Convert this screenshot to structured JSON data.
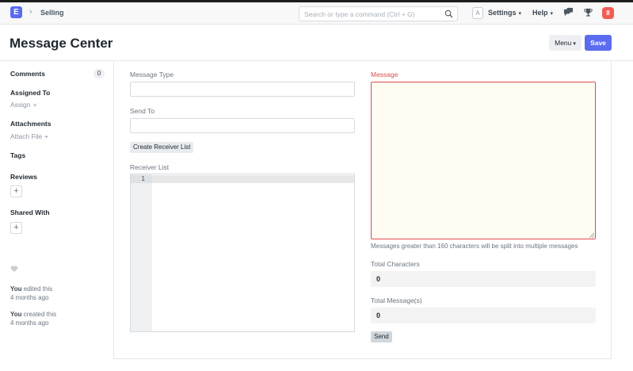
{
  "navbar": {
    "logo_letter": "E",
    "breadcrumb": "Selling",
    "search_placeholder": "Search or type a command (Ctrl + G)",
    "avatar_letter": "A",
    "settings_label": "Settings",
    "help_label": "Help",
    "notification_count": "8",
    "icons": [
      "chevron-right-icon",
      "search-icon",
      "chat-icon",
      "trophy-icon"
    ]
  },
  "page": {
    "title": "Message Center",
    "menu_label": "Menu",
    "save_label": "Save",
    "accent_color": "#5b6cf0"
  },
  "sidebar": {
    "comments_label": "Comments",
    "comments_count": "0",
    "assigned_to_label": "Assigned To",
    "assign_link": "Assign",
    "attachments_label": "Attachments",
    "attach_file_link": "Attach File",
    "tags_label": "Tags",
    "reviews_label": "Reviews",
    "shared_with_label": "Shared With",
    "activity": [
      {
        "who": "You",
        "action": "edited this",
        "when": "4 months ago"
      },
      {
        "who": "You",
        "action": "created this",
        "when": "4 months ago"
      }
    ]
  },
  "form": {
    "message_type_label": "Message Type",
    "message_type_value": "",
    "send_to_label": "Send To",
    "send_to_value": "",
    "create_receiver_list_label": "Create Receiver List",
    "receiver_list_label": "Receiver List",
    "receiver_list_line_number": "1",
    "message_label": "Message",
    "message_value": "",
    "message_help": "Messages greater than 160 characters will be split into multiple messages",
    "total_characters_label": "Total Characters",
    "total_characters_value": "0",
    "total_messages_label": "Total Message(s)",
    "total_messages_value": "0",
    "send_label": "Send",
    "required_color": "#e24c4c"
  }
}
